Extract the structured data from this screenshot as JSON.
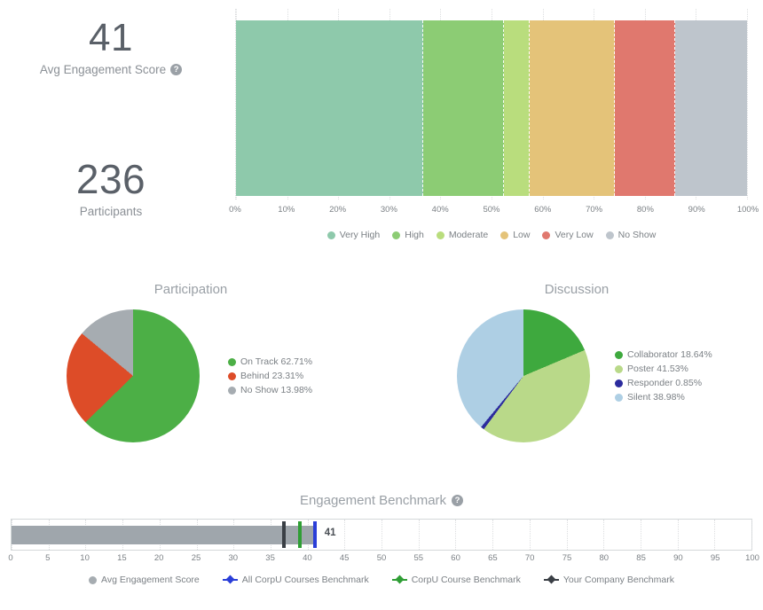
{
  "kpis": [
    {
      "value": "41",
      "label": "Avg Engagement Score",
      "has_help": true,
      "help_icon": "help-circle-icon"
    },
    {
      "value": "236",
      "label": "Participants",
      "has_help": false,
      "help_icon": ""
    }
  ],
  "stacked_bar": {
    "axis_ticks": [
      "0%",
      "10%",
      "20%",
      "30%",
      "40%",
      "50%",
      "60%",
      "70%",
      "80%",
      "90%",
      "100%"
    ],
    "legend": [
      {
        "label": "Very High",
        "color": "#8ec9ab"
      },
      {
        "label": "High",
        "color": "#8ccc74"
      },
      {
        "label": "Moderate",
        "color": "#b9dd7d"
      },
      {
        "label": "Low",
        "color": "#e4c379"
      },
      {
        "label": "Very Low",
        "color": "#e0786e"
      },
      {
        "label": "No Show",
        "color": "#bec5cc"
      }
    ]
  },
  "participation": {
    "title": "Participation",
    "legend": [
      {
        "label": "On Track 62.71%",
        "color": "#4caf46"
      },
      {
        "label": "Behind 23.31%",
        "color": "#dd4c28"
      },
      {
        "label": "No Show 13.98%",
        "color": "#a6acb1"
      }
    ]
  },
  "discussion": {
    "title": "Discussion",
    "legend": [
      {
        "label": "Collaborator 18.64%",
        "color": "#3ea93e"
      },
      {
        "label": "Poster 41.53%",
        "color": "#b9d989"
      },
      {
        "label": "Responder 0.85%",
        "color": "#2c2c9e"
      },
      {
        "label": "Silent 38.98%",
        "color": "#aecfe4"
      }
    ]
  },
  "benchmark": {
    "title": "Engagement Benchmark",
    "help_icon": "help-circle-icon",
    "value_label": "41",
    "axis_ticks": [
      "0",
      "5",
      "10",
      "15",
      "20",
      "25",
      "30",
      "35",
      "40",
      "45",
      "50",
      "55",
      "60",
      "65",
      "70",
      "75",
      "80",
      "85",
      "90",
      "95",
      "100"
    ],
    "legend": [
      {
        "label": "Avg Engagement Score",
        "color": "#a6acb1",
        "marker": "dot"
      },
      {
        "label": "All CorpU Courses Benchmark",
        "color": "#2a3ed8",
        "marker": "line"
      },
      {
        "label": "CorpU Course Benchmark",
        "color": "#2f9e35",
        "marker": "line"
      },
      {
        "label": "Your Company Benchmark",
        "color": "#3a3f45",
        "marker": "line"
      }
    ]
  },
  "chart_data": [
    {
      "type": "bar",
      "orientation": "horizontal-stacked",
      "title": "Engagement Distribution",
      "xlabel": "",
      "ylabel": "",
      "xlim": [
        0,
        100
      ],
      "grid": true,
      "legend_position": "bottom",
      "categories": [
        "Very High",
        "High",
        "Moderate",
        "Low",
        "Very Low",
        "No Show"
      ],
      "values": [
        36.7,
        15.7,
        5.0,
        16.8,
        11.8,
        14.0
      ],
      "unit": "%",
      "colors": [
        "#8ec9ab",
        "#8ccc74",
        "#b9dd7d",
        "#e4c379",
        "#e0786e",
        "#bec5cc"
      ],
      "xticks": [
        0,
        10,
        20,
        30,
        40,
        50,
        60,
        70,
        80,
        90,
        100
      ]
    },
    {
      "type": "pie",
      "title": "Participation",
      "legend_position": "right",
      "categories": [
        "On Track",
        "Behind",
        "No Show"
      ],
      "values": [
        62.71,
        23.31,
        13.98
      ],
      "unit": "%",
      "colors": [
        "#4caf46",
        "#dd4c28",
        "#a6acb1"
      ]
    },
    {
      "type": "pie",
      "title": "Discussion",
      "legend_position": "right",
      "categories": [
        "Collaborator",
        "Poster",
        "Responder",
        "Silent"
      ],
      "values": [
        18.64,
        41.53,
        0.85,
        38.98
      ],
      "unit": "%",
      "colors": [
        "#3ea93e",
        "#b9d989",
        "#2c2c9e",
        "#aecfe4"
      ]
    },
    {
      "type": "bar",
      "subtype": "bullet",
      "title": "Engagement Benchmark",
      "xlim": [
        0,
        100
      ],
      "grid": true,
      "legend_position": "bottom",
      "categories": [
        "Avg Engagement Score"
      ],
      "values": [
        41
      ],
      "markers": [
        {
          "name": "Your Company Benchmark",
          "value": 36.8,
          "color": "#3a3f45"
        },
        {
          "name": "CorpU Course Benchmark",
          "value": 39.0,
          "color": "#2f9e35"
        },
        {
          "name": "All CorpU Courses Benchmark",
          "value": 41.0,
          "color": "#2a3ed8"
        }
      ],
      "xticks": [
        0,
        5,
        10,
        15,
        20,
        25,
        30,
        35,
        40,
        45,
        50,
        55,
        60,
        65,
        70,
        75,
        80,
        85,
        90,
        95,
        100
      ]
    }
  ]
}
